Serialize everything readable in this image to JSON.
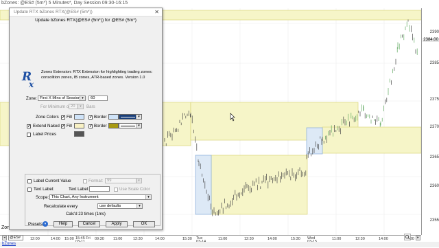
{
  "chart": {
    "title": "bZones: @ES# (5m*) 5 Minutes*, Day Session 09:30-16:15",
    "y_labels": [
      "2390",
      "2385",
      "2375",
      "2370",
      "2365",
      "2360",
      "2355"
    ],
    "price_tag": "2384.00",
    "x_labels": [
      "12:00",
      "14:00",
      "15:00",
      "15:45 Fri 03-11",
      "09:30",
      "11:00",
      "12:30",
      "14:00",
      "15:30",
      "Tue 03-14",
      "11:00",
      "12:30",
      "14:00",
      "15:30",
      "Wed 03-15",
      "11:00",
      "12:30",
      "14:00",
      "15:30"
    ],
    "zones_label": "Zones",
    "symbol": "@ES#",
    "tab_label": "bZones",
    "colors": {
      "zone_fill": "#f6f5c8",
      "zone_border": "#d9d57a",
      "blue_fill": "#dde9f6",
      "blue_border": "#8fb2dc",
      "candle": "#444444",
      "candle_up": "#5fa85f"
    }
  },
  "dialog": {
    "title": "Update RTX bZones RTX(@ES# (5m*))",
    "subtitle": "Update bZones RTX(@ES# (5m*)) for @ES# (5m*)",
    "logo_icon": "rtx-logo-icon",
    "description": "Zones Extension: RTX Extension for highlighting trading zones: consolition zones, IB zones, ATR-based zones. Version 1.0",
    "zone_label": "Zone:",
    "zone_type": "First X Mins of Session",
    "zone_minutes": "60",
    "for_minimum_label": "For Minimum of:",
    "for_minimum_value": "20",
    "bars_label": "Bars",
    "zone_colors_label": "Zone Colors",
    "fill_label": "Fill",
    "border_label": "Border",
    "extend_naked_label": "Extend Naked",
    "label_prices_label": "Label Prices",
    "label_current_value_label": "Label Current Value",
    "format_label": "Format:",
    "format_value": "99",
    "text_label_check": "Text Label:",
    "text_label_field": "Text Label:",
    "use_scale_color_label": "Use Scale Color",
    "scope_label": "Scope:",
    "scope_value": "This Chart, Any Instrument",
    "recalculate_label": "Recalculate every",
    "recalculate_value": "use defaults",
    "calc_info": "Calc'd 23 times (1ms)",
    "presets_label": "Presets",
    "help_label": "Help",
    "cancel_label": "Cancel",
    "apply_label": "Apply",
    "ok_label": "OK",
    "colors": {
      "zone_fill_swatch": "#cfe3f8",
      "zone_border_swatch": "#1a3f7a",
      "naked_fill_swatch": "#f8f1c4",
      "naked_border_swatch": "#a89a12",
      "label_swatch": "#555555"
    }
  }
}
